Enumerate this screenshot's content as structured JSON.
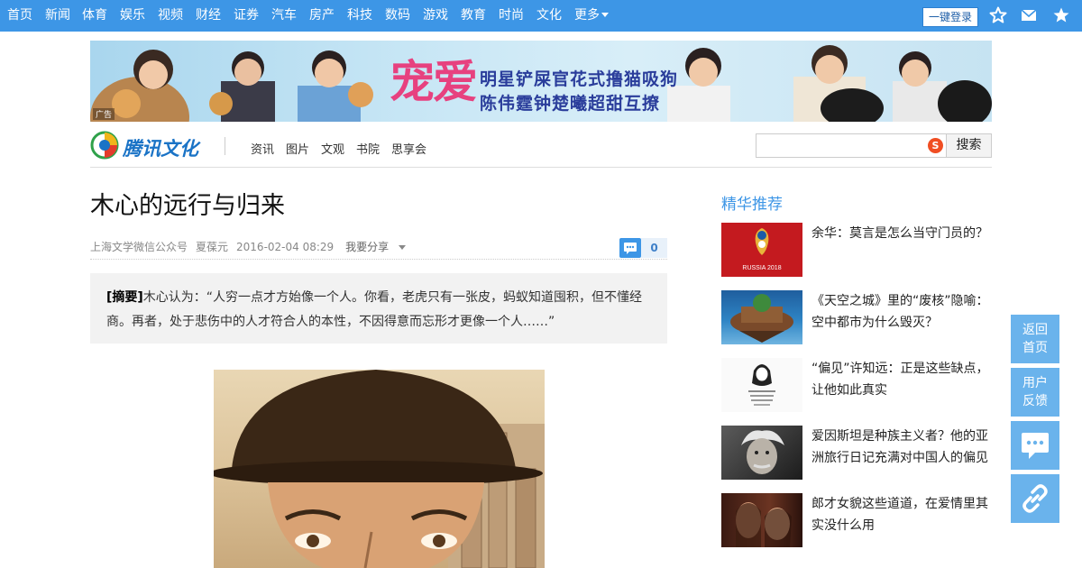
{
  "topnav": {
    "items": [
      "首页",
      "新闻",
      "体育",
      "娱乐",
      "视频",
      "财经",
      "证券",
      "汽车",
      "房产",
      "科技",
      "数码",
      "游戏",
      "教育",
      "时尚",
      "文化",
      "更多"
    ],
    "login_label": "一键登录",
    "icons": [
      "star-outline-icon",
      "mail-icon",
      "star-filled-icon",
      "chevron-down-icon"
    ]
  },
  "banner": {
    "headline": "宠爱",
    "line1": "明星铲屎官花式撸猫吸狗",
    "line2": "陈伟霆钟楚曦超甜互撩",
    "ad_tag": "广告"
  },
  "channel": {
    "logo_text": "腾讯文化",
    "links": [
      "资讯",
      "图片",
      "文观",
      "书院",
      "思享会"
    ],
    "search_placeholder": "",
    "search_logo": "S",
    "search_button": "搜索"
  },
  "article": {
    "title": "木心的远行与归来",
    "source": "上海文学微信公众号",
    "author": "夏葆元",
    "datetime": "2016-02-04 08:29",
    "share_label": "我要分享",
    "comment_count": "0",
    "summary_label": "[摘要]",
    "summary_text": "木心认为：“人穷一点才方始像一个人。你看，老虎只有一张皮，蚂蚁知道囤积，但不懂经商。再者，处于悲伤中的人才符合人的本性，不因得意而忘形才更像一个人……”"
  },
  "sidebar": {
    "heading": "精华推荐",
    "items": [
      {
        "text": "余华：莫言是怎么当守门员的？",
        "thumb_label": "RUSSIA 2018"
      },
      {
        "text": "《天空之城》里的“废核”隐喻：空中都市为什么毁灭？"
      },
      {
        "text": "“偏见”许知远：正是这些缺点，让他如此真实"
      },
      {
        "text": "爱因斯坦是种族主义者？他的亚洲旅行日记充满对中国人的偏见"
      },
      {
        "text": "郎才女貌这些道道，在爱情里其实没什么用"
      }
    ]
  },
  "floating": {
    "back_home": "返回首页",
    "feedback": "用户反馈"
  },
  "colors": {
    "nav_blue": "#3d96e6",
    "accent_blue": "#3d96e6",
    "float_blue": "#6ab3ec"
  }
}
